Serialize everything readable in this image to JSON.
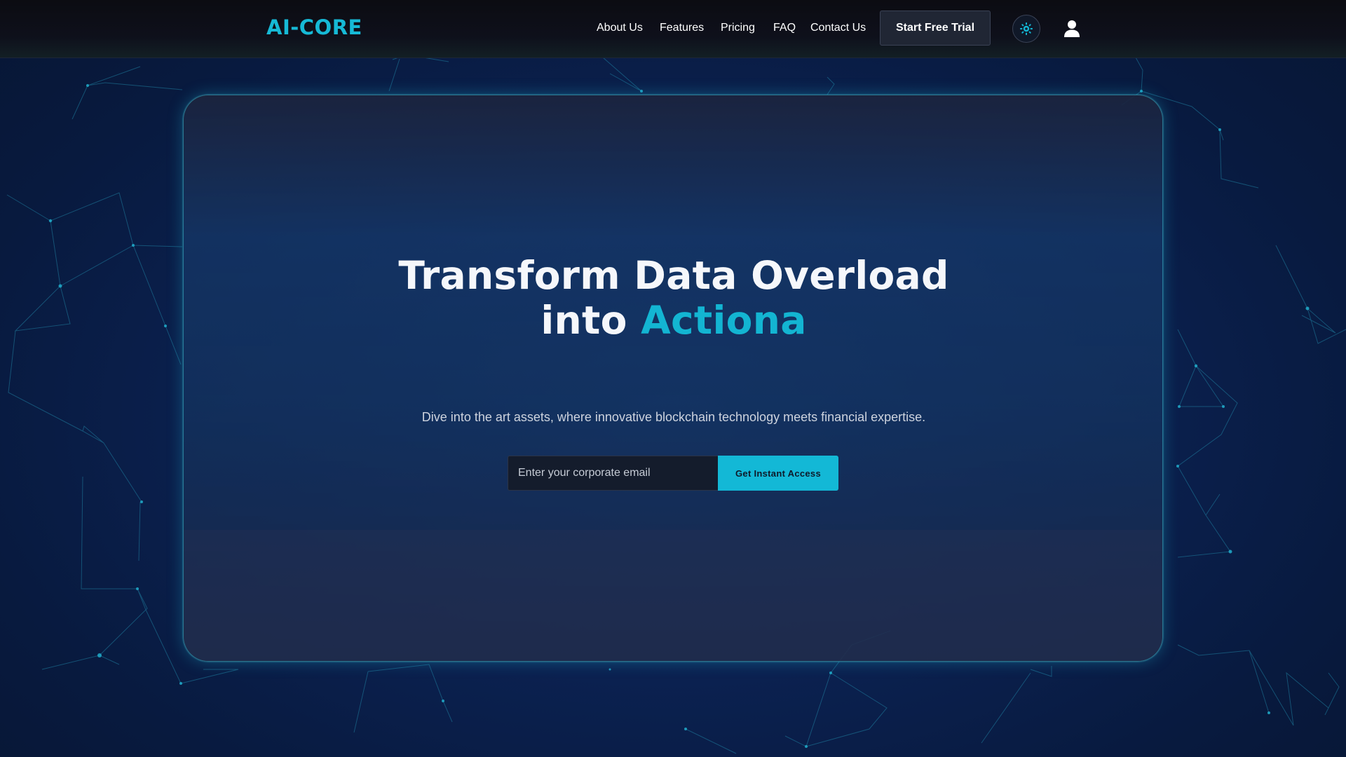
{
  "header": {
    "logo": "AI-CORE",
    "nav": [
      {
        "label": "About Us"
      },
      {
        "label": "Features"
      },
      {
        "label": "Pricing"
      },
      {
        "label": "FAQ"
      },
      {
        "label": "Contact Us"
      }
    ],
    "cta_label": "Start Free Trial",
    "theme_icon": "sun-gear-icon",
    "user_icon": "user-icon"
  },
  "hero": {
    "headline_line1": "Transform Data Overload",
    "headline_line2_prefix": "into",
    "headline_line2_accent": "Actiona",
    "subtitle": "Dive into the art assets, where innovative blockchain technology meets financial expertise.",
    "email_placeholder": "Enter your corporate email",
    "submit_label": "Get Instant Access"
  },
  "colors": {
    "accent": "#13b5d2",
    "background": "#0b2150",
    "topbar": "#0c0c12"
  }
}
